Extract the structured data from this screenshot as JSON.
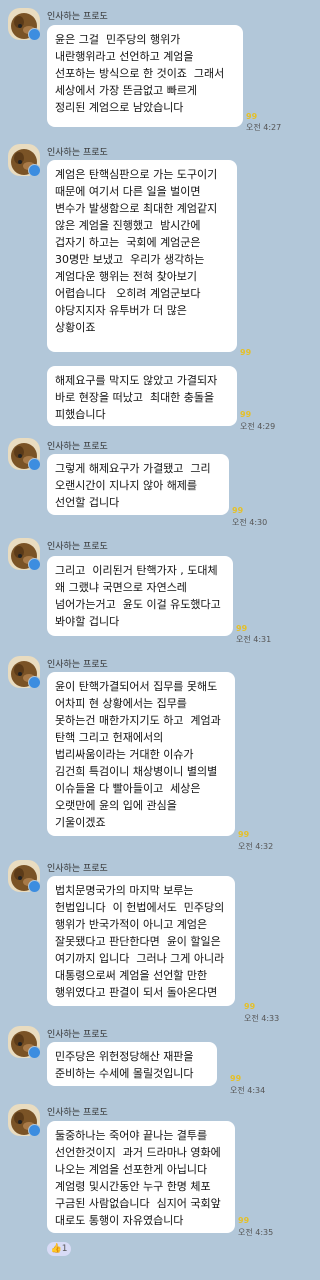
{
  "sender": "인사하는 프로도",
  "messages": [
    {
      "text": "윤은 그걸  민주당의 행위가\n내란행위라고 선언하고 계엄을\n선포하는 방식으로 한 것이죠  그래서\n세상에서 가장 뜬금없고 빠르게\n정리된 계엄으로 남았습니다",
      "unread": "99",
      "time": "오전 4:27"
    },
    {
      "text": "계엄은 탄핵심판으로 가는 도구이기\n때문에 여기서 다른 일을 벌이면\n변수가 발생함으로 최대한 계엄같지\n않은 계엄을 진행했고  밤시간에\n겁자기 하고는  국회에 계엄군은\n30명만 보냈고  우리가 생각하는\n계엄다운 행위는 전혀 찾아보기\n어렵습니다   오히려 계엄군보다\n야당지지자 유투버가 더 많은\n상황이죠",
      "unread": "99"
    },
    {
      "text": "해제요구를 막지도 않았고 가결되자\n바로 현장을 떠났고  최대한 충돌을\n피했습니다",
      "unread": "99",
      "time": "오전 4:29"
    },
    {
      "text": "그렇게 해제요구가 가결됐고  그리\n오랜시간이 지나지 않아 해제를\n선언할 겁니다",
      "unread": "99",
      "time": "오전 4:30"
    },
    {
      "text": "그리고  이리된거 탄핵가자 , 도대체\n왜 그랬냐 국면으로 자연스레\n넘어가는거고  윤도 이걸 유도했다고\n봐야할 겁니다",
      "unread": "99",
      "time": "오전 4:31"
    },
    {
      "text": "윤이 탄핵가결되어서 집무를 못해도\n어차피 현 상황에서는 집무를\n못하는건 매한가지기도 하고  계엄과\n탄핵 그리고 헌재에서의\n법리싸움이라는 거대한 이슈가\n김건희 특검이니 채상병이니 별의별\n이슈들을 다 빨아들이고  세상은\n오랫만에 윤의 입에 관심을\n기울이겠죠",
      "unread": "99",
      "time": "오전 4:32"
    },
    {
      "text": "법치문명국가의 마지막 보루는\n헌법입니다  이 헌법에서도  민주당의\n행위가 반국가적이 아니고 계엄은\n잘못됐다고 판단한다면  윤이 할일은\n여기까지 입니다  그러나 그게 아니라\n대통령으로써 계엄을 선언할 만한\n행위였다고 판결이 되서 돌아온다면",
      "unread": "99",
      "time": "오전 4:33"
    },
    {
      "text": "민주당은 위헌정당해산 재판을\n준비하는 수세에 몰릴것입니다",
      "unread": "99",
      "time": "오전 4:34"
    },
    {
      "text": "둘중하나는 죽어야 끝나는 결투를\n선언한것이지  과거 드라마나 영화에\n나오는 계엄을 선포한게 아닙니다\n계엄령 및시간동안 누구 한명 체포\n구금된 사람없습니다  심지어 국회앞\n대로도 통행이 자유였습니다",
      "unread": "99",
      "time": "오전 4:35"
    }
  ],
  "reaction": {
    "icon": "thumbs-up-icon",
    "count": "1"
  },
  "colors": {
    "background": "#b2c7d9",
    "bubble": "#ffffff",
    "unread": "#e4c02a",
    "badge": "#3c8de0"
  }
}
